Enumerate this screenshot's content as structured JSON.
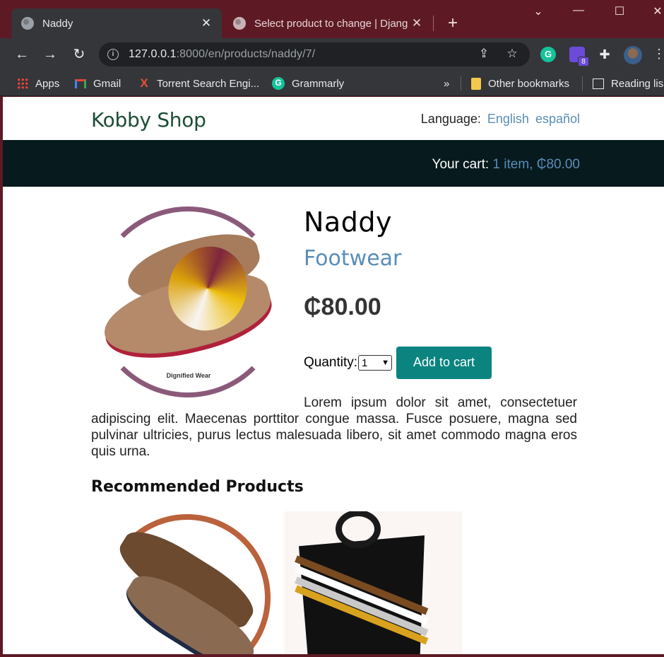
{
  "browser": {
    "tabs": [
      {
        "title": "Naddy",
        "close": "✕"
      },
      {
        "title": "Select product to change | Djang",
        "close": "✕"
      }
    ],
    "new_tab": "+",
    "window_controls": {
      "minimize": "—",
      "maximize": "☐",
      "close": "✕",
      "tab_search": "⌄"
    },
    "url_host": "127.0.0.1",
    "url_rest": ":8000/en/products/naddy/7/",
    "extension_badge": "8",
    "bookmarks": [
      {
        "label": "Apps",
        "icon": "apps-icon"
      },
      {
        "label": "Gmail",
        "icon": "gmail-icon"
      },
      {
        "label": "Torrent Search Engi...",
        "icon": "torrent-icon"
      },
      {
        "label": "Grammarly",
        "icon": "grammarly-icon"
      }
    ],
    "bookmarks_overflow": "»",
    "other_bookmarks": "Other bookmarks",
    "reading_list": "Reading lis"
  },
  "site": {
    "logo": "Kobby Shop",
    "language_label": "Language:",
    "languages": [
      "English",
      "español"
    ],
    "cart_label": "Your cart:",
    "cart_summary": "1 item, ₵80.00"
  },
  "product": {
    "name": "Naddy",
    "category": "Footwear",
    "price": "₵80.00",
    "image_caption": "Dignified Wear",
    "quantity_label": "Quantity:",
    "quantity_value": "1",
    "add_to_cart": "Add to cart",
    "description": "Lorem ipsum dolor sit amet, consectetuer adipiscing elit. Maecenas porttitor congue massa. Fusce posuere, magna sed pulvinar ultricies, purus lectus malesuada libero, sit amet commodo magna eros quis urna."
  },
  "recommended": {
    "title": "Recommended Products"
  },
  "colors": {
    "accent_button": "#0b8480",
    "link": "#5a8db8",
    "cartbar": "#071a1d",
    "browser_frame": "#5e1a24"
  }
}
